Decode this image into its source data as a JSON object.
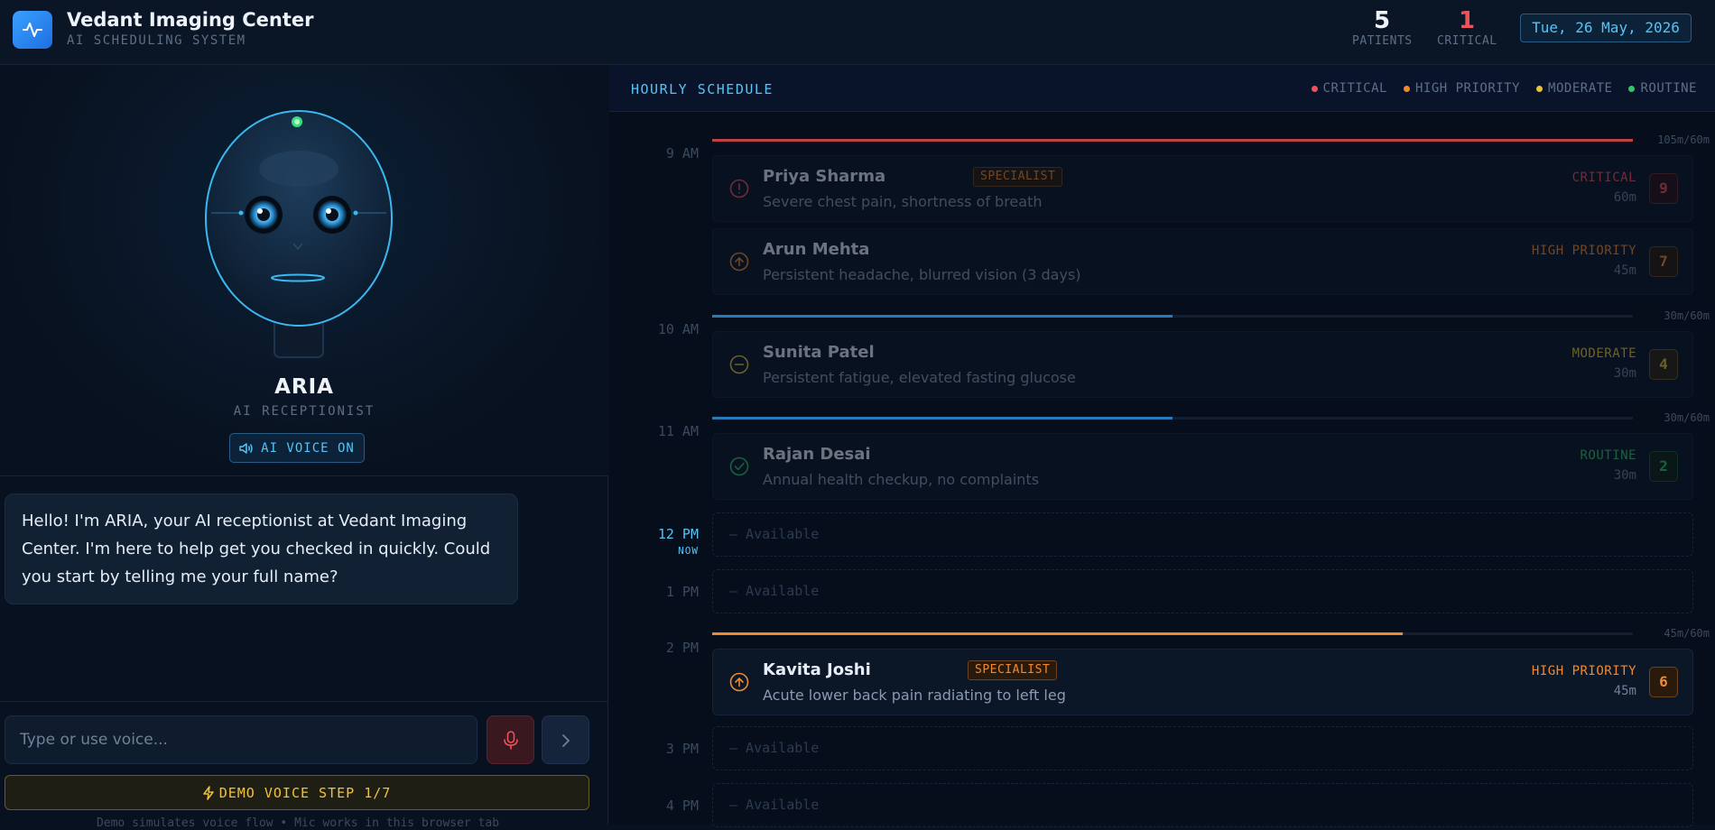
{
  "app": {
    "title": "Vedant Imaging Center",
    "subtitle": "AI SCHEDULING SYSTEM",
    "accent": "#3aa0ff"
  },
  "stats": {
    "patients_value": "5",
    "patients_label": "PATIENTS",
    "critical_value": "1",
    "critical_label": "CRITICAL"
  },
  "date": "Tue, 26 May, 2026",
  "assistant": {
    "name": "ARIA",
    "role": "AI RECEPTIONIST",
    "voice_label": "AI VOICE ON",
    "greeting": "Hello! I'm ARIA, your AI receptionist at Vedant Imaging Center. I'm here to help get you checked in quickly. Could you start by telling me your full name?"
  },
  "chat": {
    "input_placeholder": "Type or use voice...",
    "demo_label": "DEMO VOICE STEP 1/7",
    "demo_note": "Demo simulates voice flow • Mic works in this browser tab"
  },
  "schedule": {
    "title": "HOURLY SCHEDULE",
    "legend": [
      {
        "label": "CRITICAL",
        "color": "#f0505a"
      },
      {
        "label": "HIGH PRIORITY",
        "color": "#f08a30"
      },
      {
        "label": "MODERATE",
        "color": "#e8c23a"
      },
      {
        "label": "ROUTINE",
        "color": "#34c46a"
      }
    ],
    "hours": {
      "h9": "9 AM",
      "h10": "10 AM",
      "h11": "11 AM",
      "h12": "12 PM",
      "now": "NOW",
      "h1": "1 PM",
      "h2": "2 PM",
      "h3": "3 PM",
      "h4": "4 PM"
    },
    "capacity": {
      "h9": {
        "text": "105m/60m",
        "fraction": 1.0,
        "color": "#c0404a"
      },
      "h10": {
        "text": "30m/60m",
        "fraction": 0.5,
        "color": "#2a7ab8"
      },
      "h11": {
        "text": "30m/60m",
        "fraction": 0.5,
        "color": "#2a7ab8"
      },
      "h2": {
        "text": "45m/60m",
        "fraction": 0.75,
        "color": "#f08a30"
      }
    },
    "available_label": "— Available",
    "appointments": {
      "priya": {
        "name": "Priya Sharma",
        "tag": "SPECIALIST",
        "desc": "Severe chest pain, shortness of breath",
        "priority": "CRITICAL",
        "duration": "60m",
        "score": "9",
        "color": "#f0505a"
      },
      "arun": {
        "name": "Arun Mehta",
        "desc": "Persistent headache, blurred vision (3 days)",
        "priority": "HIGH PRIORITY",
        "duration": "45m",
        "score": "7",
        "color": "#f08a30"
      },
      "sunita": {
        "name": "Sunita Patel",
        "desc": "Persistent fatigue, elevated fasting glucose",
        "priority": "MODERATE",
        "duration": "30m",
        "score": "4",
        "color": "#e8c23a"
      },
      "rajan": {
        "name": "Rajan Desai",
        "desc": "Annual health checkup, no complaints",
        "priority": "ROUTINE",
        "duration": "30m",
        "score": "2",
        "color": "#34c46a"
      },
      "kavita": {
        "name": "Kavita Joshi",
        "tag": "SPECIALIST",
        "desc": "Acute lower back pain radiating to left leg",
        "priority": "HIGH PRIORITY",
        "duration": "45m",
        "score": "6",
        "color": "#f08a30"
      }
    }
  }
}
